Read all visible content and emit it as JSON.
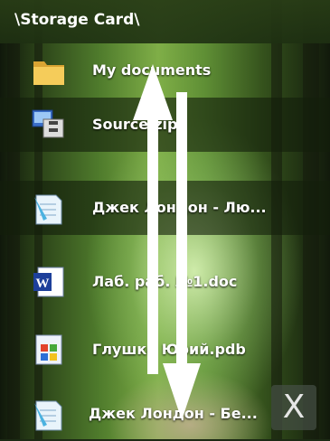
{
  "window": {
    "path": "\\Storage Card\\"
  },
  "files": [
    {
      "name": "My documents",
      "icon": "folder-icon"
    },
    {
      "name": "Source.zip",
      "icon": "zip-archive-icon"
    },
    {
      "name": "Джек Лондон - Лю...",
      "icon": "notepad-document-icon"
    },
    {
      "name": "Лаб. раб. №1.doc",
      "icon": "word-document-icon"
    },
    {
      "name": "Глушко Юрий.pdb",
      "icon": "windows-file-icon"
    },
    {
      "name": "Джек Лондон - Бе...",
      "icon": "notepad-document-icon"
    }
  ],
  "close_button": {
    "label": "X"
  },
  "scroll_gesture": {
    "icon": "up-down-scroll-arrows-icon"
  }
}
